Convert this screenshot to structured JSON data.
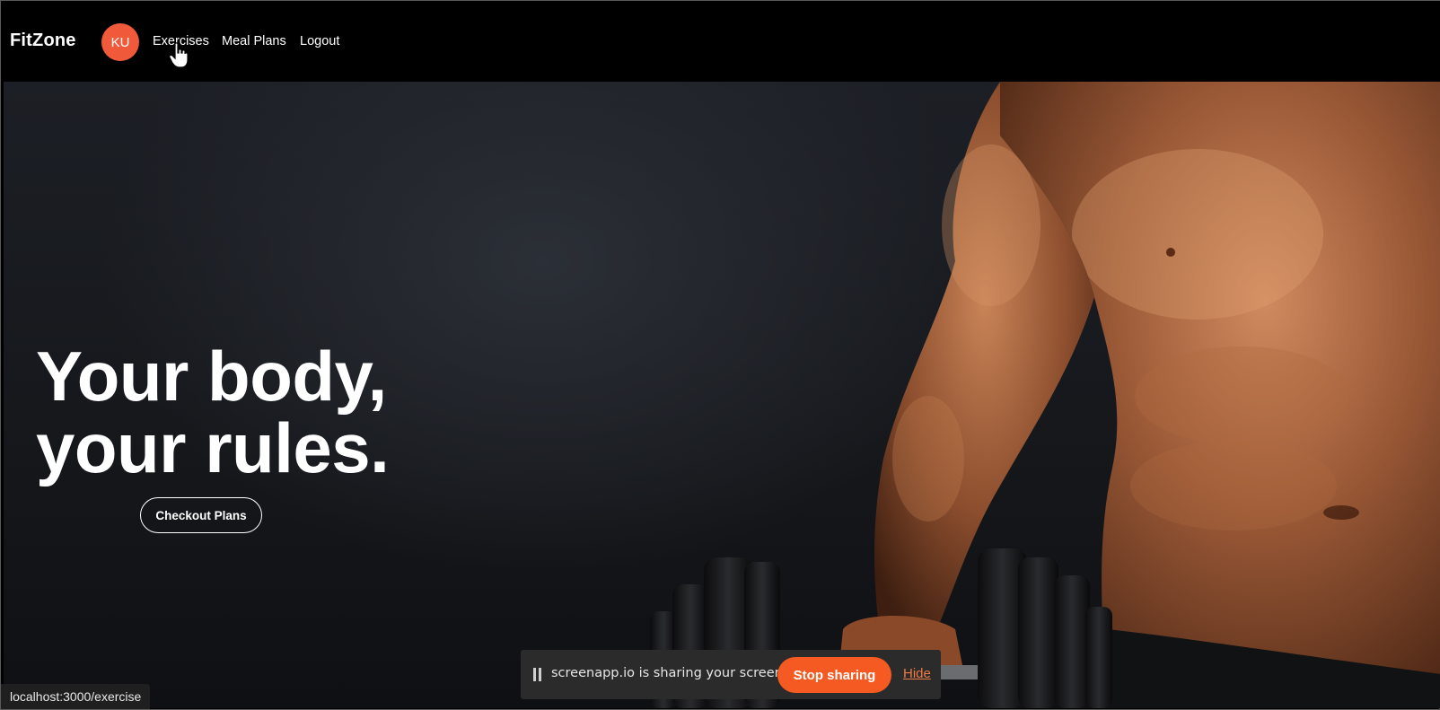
{
  "header": {
    "brand": "FitZone",
    "avatar_initials": "KU",
    "nav": [
      {
        "label": "Exercises"
      },
      {
        "label": "Meal Plans"
      },
      {
        "label": "Logout"
      }
    ]
  },
  "hero": {
    "headline_line1": "Your body,",
    "headline_line2": "your rules.",
    "cta_label": "Checkout Plans"
  },
  "status_bar": {
    "url": "localhost:3000/exercise"
  },
  "screen_share": {
    "message": "screenapp.io is sharing your screen.",
    "stop_label": "Stop sharing",
    "hide_label": "Hide"
  },
  "colors": {
    "accent": "#f05a3a",
    "share_button": "#f55a23",
    "background": "#000000"
  }
}
